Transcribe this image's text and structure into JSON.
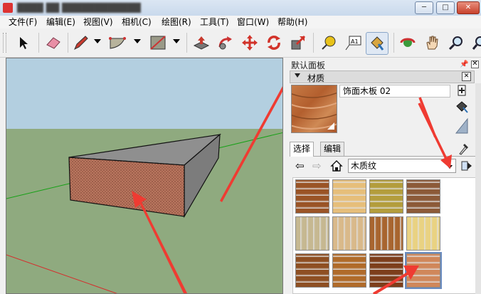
{
  "menu": [
    "文件(F)",
    "编辑(E)",
    "视图(V)",
    "相机(C)",
    "绘图(R)",
    "工具(T)",
    "窗口(W)",
    "帮助(H)"
  ],
  "toolbar": {
    "tools": [
      "select",
      "eraser",
      "pencil",
      "arc",
      "rectangle",
      "push-pull",
      "follow-me",
      "move",
      "rotate",
      "scale",
      "tape-measure",
      "text",
      "paint-bucket",
      "orbit",
      "pan",
      "zoom",
      "zoom-extents"
    ],
    "active_tool": "paint-bucket"
  },
  "panel": {
    "title": "默认面板",
    "tray_label": "材质",
    "material_name": "饰面木板 02",
    "tabs": [
      "选择",
      "编辑"
    ],
    "active_tab": "选择",
    "library": "木质纹",
    "selected_swatch": 11
  },
  "colors": {
    "sky": "#b3cfe0",
    "ground": "#8faa7f",
    "box_face": "#b9765f",
    "box_top": "#8f8f8f",
    "box_side": "#7c7c7c",
    "arrow": "#ef3b32",
    "axis_green": "#17a117",
    "axis_red": "#d62c2c"
  },
  "swatch_colors": [
    "#9a5426",
    "#e6be7a",
    "#b39d3c",
    "#8c5a38",
    "#c6b891",
    "#d9b98a",
    "#a8652f",
    "#e9d282",
    "#8e4f22",
    "#b06b2a",
    "#7d3e1b",
    "#d0875a"
  ]
}
